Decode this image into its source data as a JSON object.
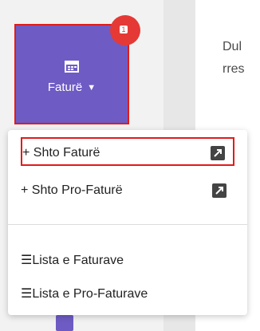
{
  "page": {
    "partial_text": "Dul\nrres"
  },
  "menu_button": {
    "label": "Faturë",
    "icon": "calendar-icon",
    "accent": "#6f5bc4",
    "highlight": "#e11b1b"
  },
  "badge": {
    "color": "#e53935",
    "count": "1"
  },
  "dropdown": {
    "items": [
      {
        "label": "+ Shto Faturë",
        "icon": "external-link-icon"
      },
      {
        "label": "+ Shto Pro-Faturë",
        "icon": "external-link-icon"
      },
      {
        "label": "☰Lista e Faturave",
        "icon": "list-icon"
      },
      {
        "label": "☰Lista e Pro-Faturave",
        "icon": "list-icon"
      }
    ]
  }
}
